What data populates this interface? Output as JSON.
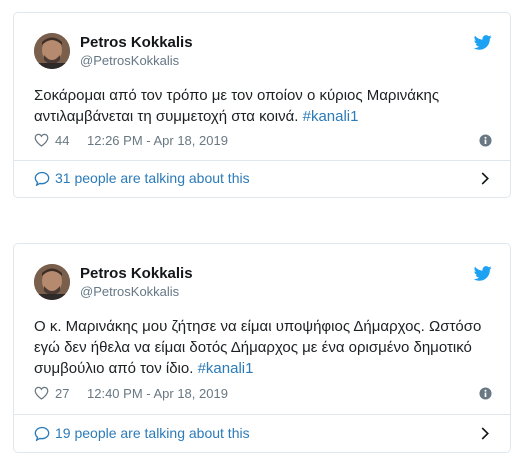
{
  "tweets": [
    {
      "author": {
        "name": "Petros Kokkalis",
        "handle": "@PetrosKokkalis"
      },
      "text_lines": [
        "Σοκάρομαι από τον τρόπο με τον οποίον ο κύριος Μαρινάκης",
        "αντιλαμβάνεται τη συμμετοχή στα κοινά."
      ],
      "hashtag": "#kanali1",
      "likes": "44",
      "timestamp": "12:26 PM - Apr 18, 2019",
      "talking": "31 people are talking about this"
    },
    {
      "author": {
        "name": "Petros Kokkalis",
        "handle": "@PetrosKokkalis"
      },
      "text_lines": [
        "Ο κ. Μαρινάκης μου ζήτησε να είμαι υποψήφιος Δήμαρχος. Ωστόσο",
        "εγώ δεν ήθελα να είμαι δοτός Δήμαρχος με ένα ορισμένο δημοτικό",
        "συμβούλιο από τον ίδιο."
      ],
      "hashtag": "#kanali1",
      "likes": "27",
      "timestamp": "12:40 PM - Apr 18, 2019",
      "talking": "19 people are talking about this"
    }
  ],
  "colors": {
    "link": "#2b7bb9",
    "twitter_blue": "#1da1f2",
    "muted": "#697882",
    "border": "#e1e8ed"
  },
  "icons": [
    "twitter-bird-icon",
    "heart-icon",
    "info-icon",
    "speech-bubble-icon",
    "chevron-right-icon"
  ]
}
